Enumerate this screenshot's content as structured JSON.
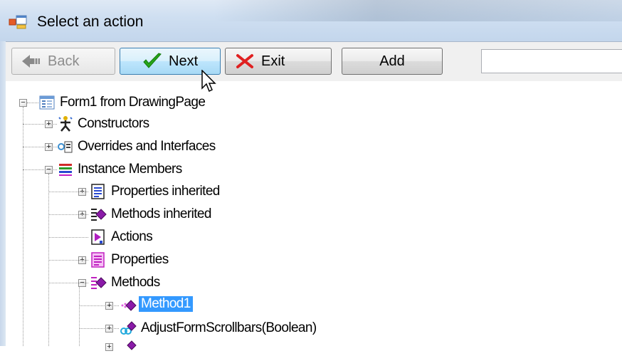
{
  "window": {
    "title": "Select an action"
  },
  "toolbar": {
    "back_label": "Back",
    "next_label": "Next",
    "exit_label": "Exit",
    "add_label": "Add",
    "address_value": ""
  },
  "tree": {
    "root": "Form1 from DrawingPage",
    "items": [
      {
        "label": "Constructors",
        "icon": "constructors-icon"
      },
      {
        "label": "Overrides and Interfaces",
        "icon": "interfaces-icon"
      },
      {
        "label": "Instance Members",
        "icon": "members-icon"
      },
      {
        "label": "Properties inherited",
        "icon": "properties-icon"
      },
      {
        "label": "Methods inherited",
        "icon": "methods-icon"
      },
      {
        "label": "Actions",
        "icon": "actions-icon"
      },
      {
        "label": "Properties",
        "icon": "properties-icon"
      },
      {
        "label": "Methods",
        "icon": "methods-icon"
      },
      {
        "label": "Method1",
        "icon": "method-icon",
        "selected": true
      },
      {
        "label": "AdjustFormScrollbars(Boolean)",
        "icon": "method-icon"
      }
    ]
  },
  "colors": {
    "selection": "#3399ff",
    "title_bar": "#cfdff1",
    "toolbar": "#f0f0f0"
  }
}
